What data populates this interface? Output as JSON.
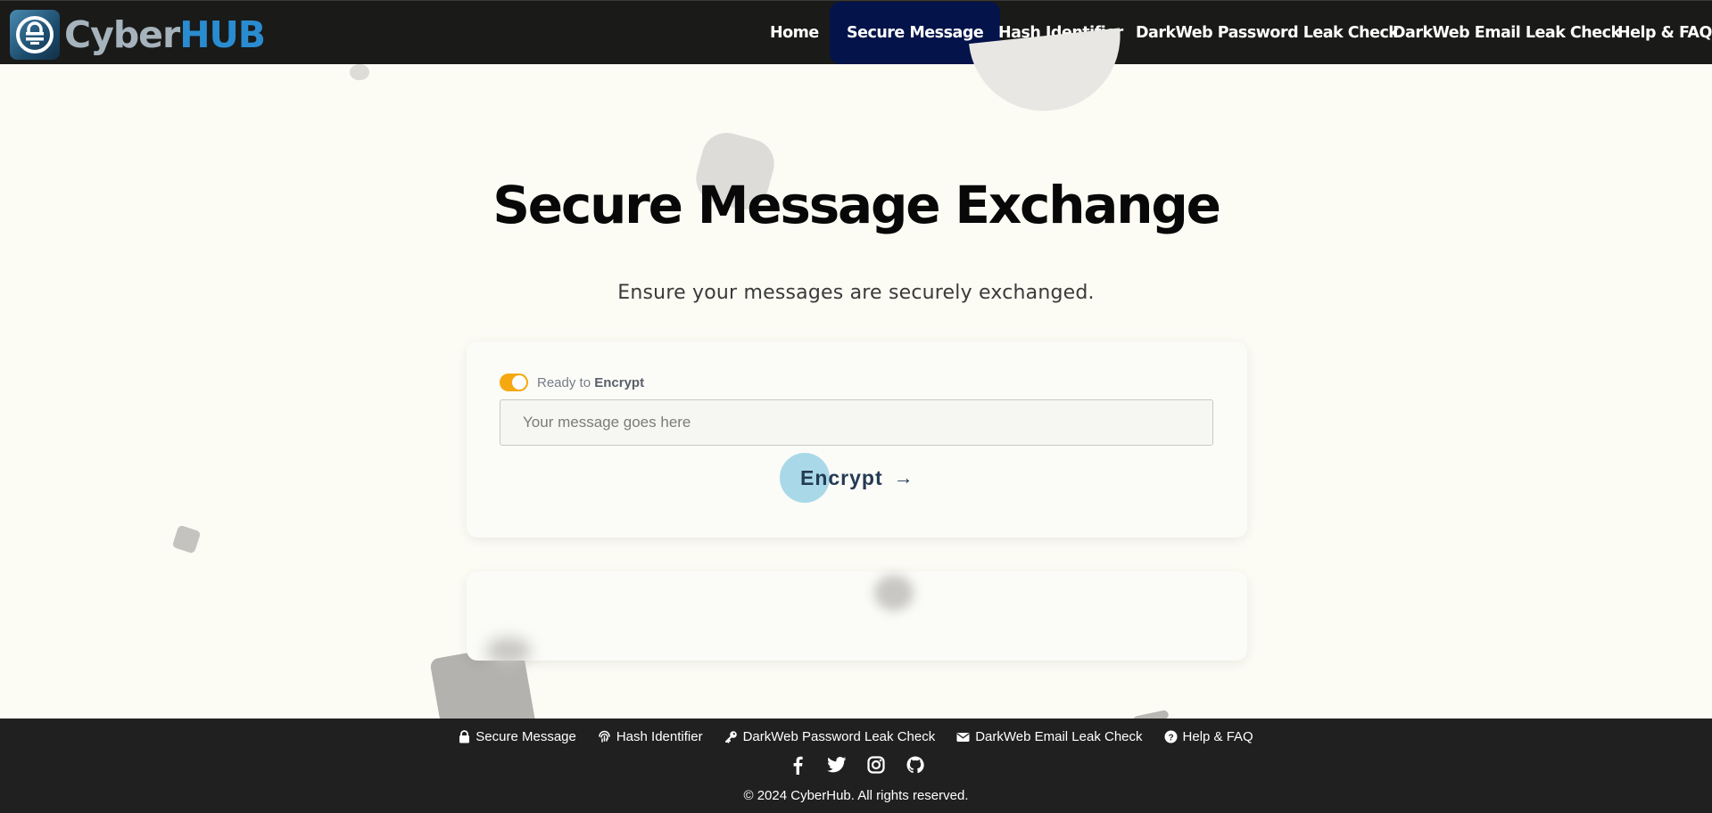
{
  "brand": {
    "part1": "Cyber",
    "part2": "HUB"
  },
  "nav": {
    "home": "Home",
    "secure_message": "Secure Message",
    "hash_identifier": "Hash Identifier",
    "password_leak": "DarkWeb Password Leak Check",
    "email_leak": "DarkWeb Email Leak Check",
    "help": "Help & FAQ",
    "active": "Secure Message"
  },
  "main": {
    "title": "Secure Message Exchange",
    "subtitle": "Ensure your messages are securely exchanged."
  },
  "form": {
    "toggle_prefix": "Ready to",
    "toggle_mode": "Encrypt",
    "toggle_on": true,
    "message_placeholder": "Your message goes here",
    "message_value": "",
    "submit_label": "Encrypt",
    "submit_arrow": "→"
  },
  "footer": {
    "links": {
      "secure_message": "Secure Message",
      "hash_identifier": "Hash Identifier",
      "password_leak": "DarkWeb Password Leak Check",
      "email_leak": "DarkWeb Email Leak Check",
      "help": "Help & FAQ"
    },
    "socials": [
      "facebook-icon",
      "twitter-icon",
      "instagram-icon",
      "github-icon"
    ],
    "copyright": "© 2024 CyberHub. All rights reserved."
  },
  "colors": {
    "nav_bg": "#1a1a18",
    "nav_active": "#04134a",
    "brand_blue": "#2a8cd0",
    "toggle_on": "#f5a810",
    "button_circle": "#a9d9e8",
    "page_bg": "#fcfbf4",
    "footer_bg": "#202020"
  }
}
